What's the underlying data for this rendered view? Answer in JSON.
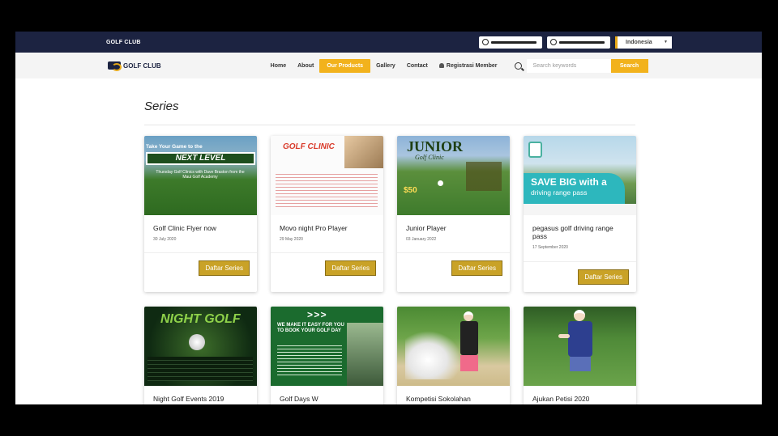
{
  "topbar": {
    "brand": "GOLF CLUB",
    "language": "Indonesia"
  },
  "nav": {
    "logo_text": "GOLF CLUB",
    "items": [
      "Home",
      "About",
      "Our Products",
      "Gallery",
      "Contact",
      "Registrasi Member"
    ],
    "active": "Our Products",
    "search_placeholder": "Search keywords",
    "search_button": "Search"
  },
  "page": {
    "title": "Series"
  },
  "cards": [
    {
      "title": "Golf Clinic Flyer now",
      "date": "30 July 2020",
      "button": "Daftar Series"
    },
    {
      "title": "Movo night Pro Player",
      "date": "29 May 2020",
      "button": "Daftar Series"
    },
    {
      "title": "Junior Player",
      "date": "03 January 2022",
      "button": "Daftar Series"
    },
    {
      "title": "pegasus golf driving range pass",
      "date": "17 September 2020",
      "button": "Daftar Series"
    },
    {
      "title": "Night Golf Events 2019"
    },
    {
      "title": "Golf Days W"
    },
    {
      "title": "Kompetisi Sokolahan"
    },
    {
      "title": "Ajukan Petisi 2020"
    }
  ],
  "thumbs": {
    "flyer_top": "Take Your Game to the",
    "flyer_band": "NEXT LEVEL",
    "flyer_lines": "Thursday Golf Clinics with Dave Braston from the Maui Golf Academy",
    "movo_head": "GOLF CLINIC",
    "junior_big": "JUNIOR",
    "junior_sub": "Golf Clinic",
    "junior_price": "$50",
    "pegasus_save": "SAVE BIG with a",
    "pegasus_drv": "driving range pass",
    "night_txt": "NIGHT GOLF",
    "days_arrows": "> > >",
    "days_head": "WE MAKE IT EASY FOR YOU TO BOOK YOUR GOLF DAY"
  }
}
